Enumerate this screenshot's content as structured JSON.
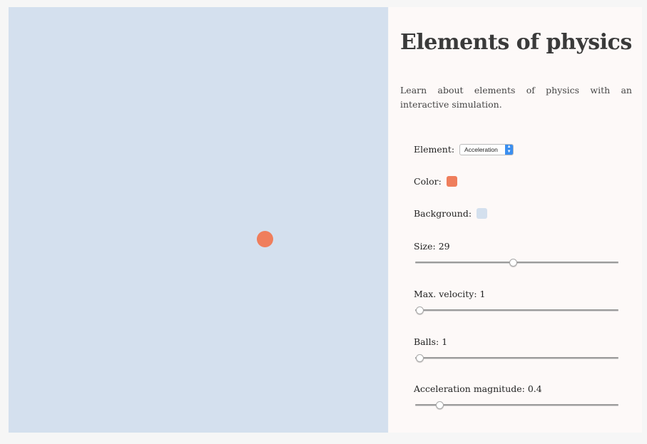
{
  "panel": {
    "title": "Elements of physics",
    "intro": "Learn about elements of physics with an interactive simulation."
  },
  "controls": {
    "element": {
      "label": "Element:",
      "value": "Acceleration"
    },
    "color": {
      "label": "Color:",
      "value": "#ef7e5c"
    },
    "background": {
      "label": "Background:",
      "value": "#d4e0ee"
    },
    "sliders": [
      {
        "label": "Size: 29",
        "fraction": 0.48
      },
      {
        "label": "Max. velocity: 1",
        "fraction": 0.02
      },
      {
        "label": "Balls: 1",
        "fraction": 0.02
      },
      {
        "label": "Acceleration magnitude: 0.4",
        "fraction": 0.12
      }
    ]
  },
  "colors": {
    "ball": "#ef7e5c",
    "stage_background": "#d4e0ee",
    "panel_background": "#fdf9f8"
  }
}
